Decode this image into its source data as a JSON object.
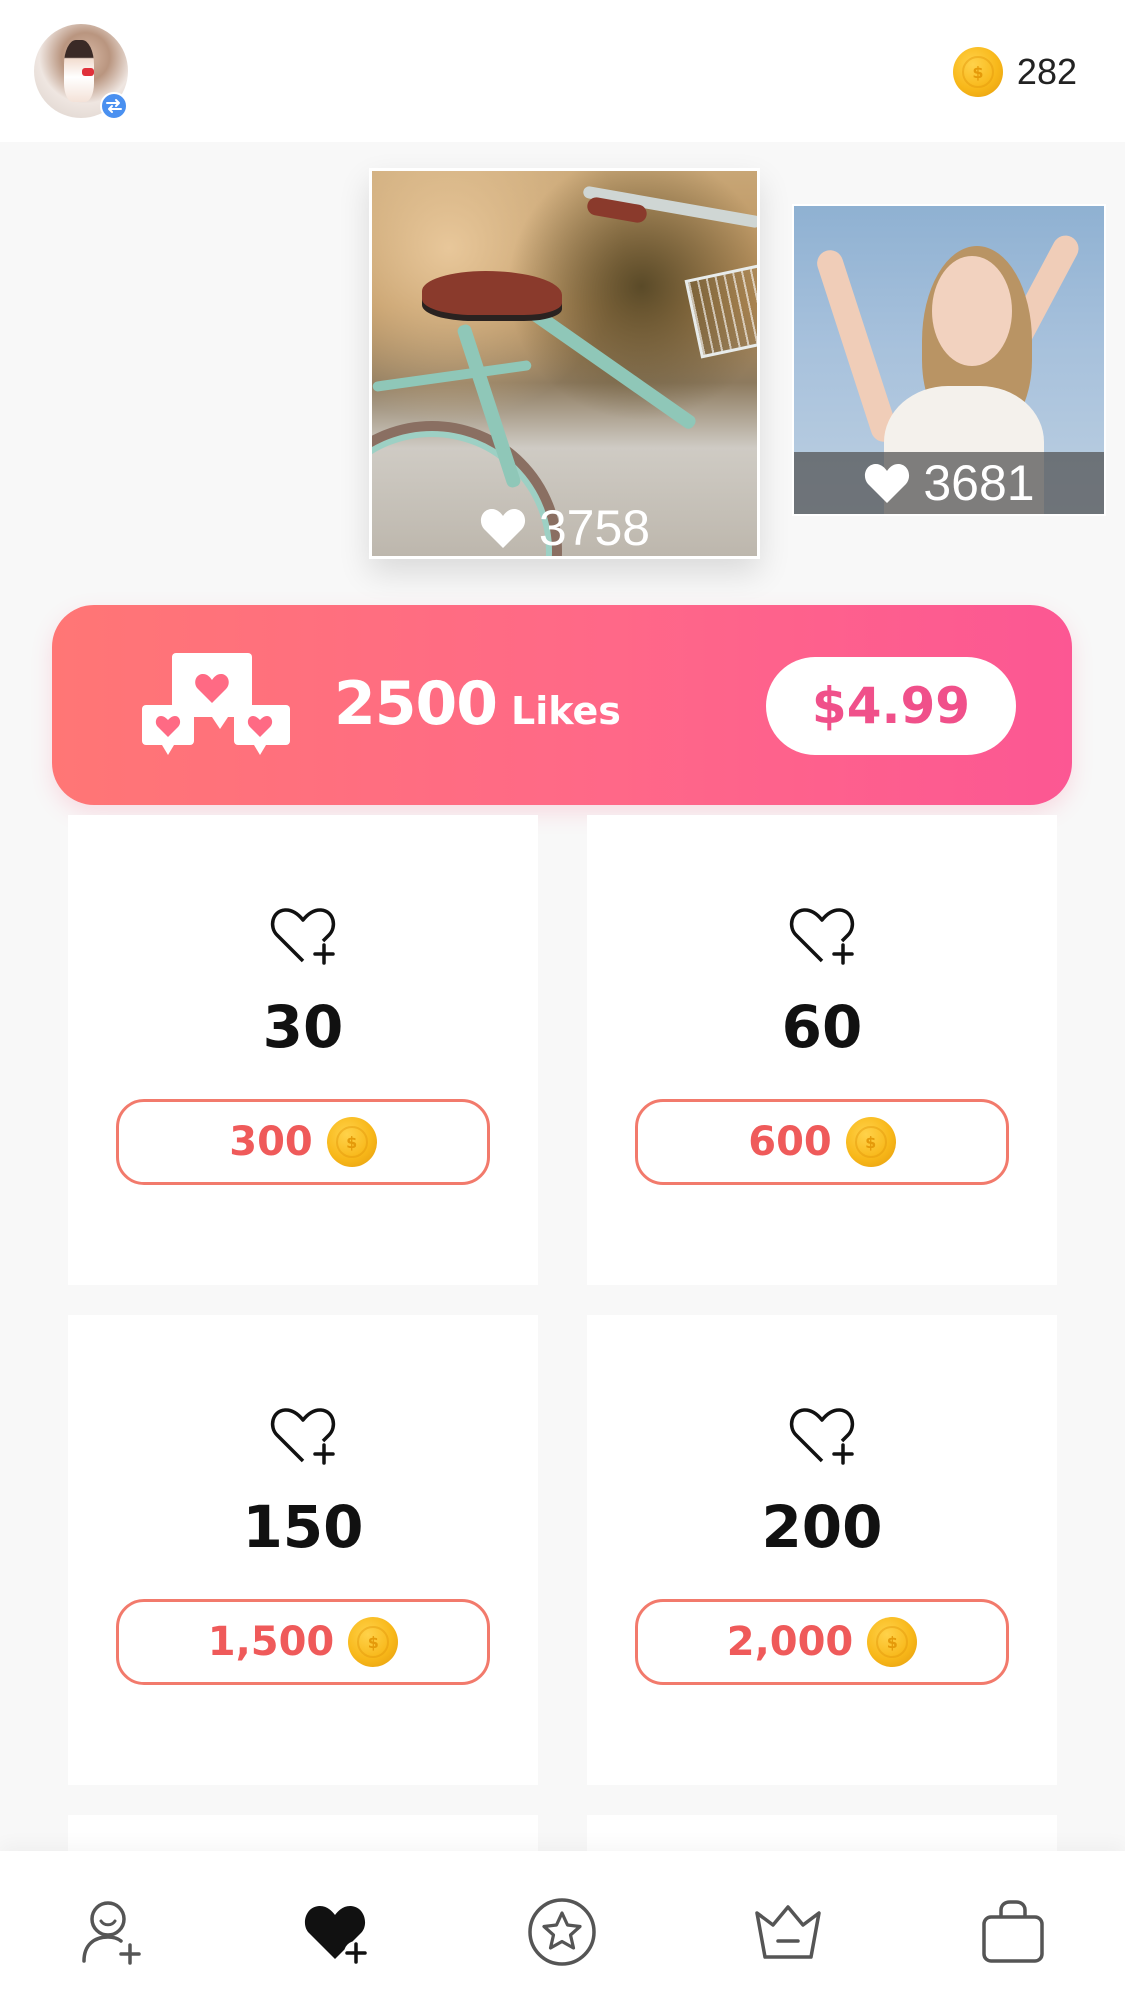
{
  "header": {
    "coin_balance": "282",
    "avatar_alt": "profile",
    "swap_icon": "swap-icon"
  },
  "carousel": {
    "photos": [
      {
        "likes": "3758",
        "subject": "bicycle"
      },
      {
        "likes": "3681",
        "subject": "woman"
      }
    ]
  },
  "promo": {
    "amount": "2500",
    "unit": "Likes",
    "price": "$4.99"
  },
  "packages": [
    {
      "likes": "30",
      "cost": "300"
    },
    {
      "likes": "60",
      "cost": "600"
    },
    {
      "likes": "150",
      "cost": "1,500"
    },
    {
      "likes": "200",
      "cost": "2,000"
    }
  ],
  "nav": {
    "items": [
      {
        "icon": "follower-add-icon",
        "active": false
      },
      {
        "icon": "heart-plus-icon",
        "active": true
      },
      {
        "icon": "star-circle-icon",
        "active": false
      },
      {
        "icon": "crown-icon",
        "active": false
      },
      {
        "icon": "shopping-bag-icon",
        "active": false
      }
    ]
  },
  "colors": {
    "accent_pink": "#fc5793",
    "accent_coral": "#ff7675",
    "coin_gold": "#f8b81a",
    "price_red": "#ef5a5a"
  }
}
